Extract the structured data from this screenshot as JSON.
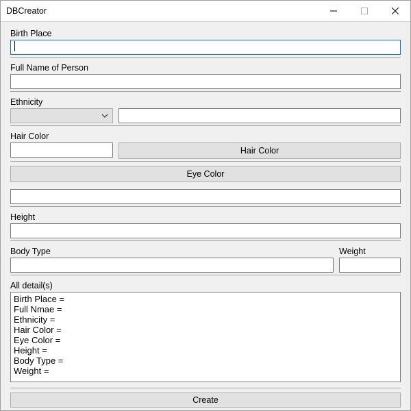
{
  "window": {
    "title": "DBCreator"
  },
  "labels": {
    "birth_place": "Birth Place",
    "full_name": "Full Name of Person",
    "ethnicity": "Ethnicity",
    "hair_color": "Hair Color",
    "height": "Height",
    "body_type": "Body Type",
    "weight": "Weight",
    "all_details": "All detail(s)"
  },
  "buttons": {
    "hair_color": "Hair Color",
    "eye_color": "Eye Color",
    "create": "Create"
  },
  "inputs": {
    "birth_place": "",
    "full_name": "",
    "ethnicity_selected": "",
    "ethnicity_text": "",
    "hair_color": "",
    "eye_color_result": "",
    "height": "",
    "body_type": "",
    "weight": ""
  },
  "details_text": "Birth Place = \nFull Nmae = \nEthnicity = \nHair Color = \nEye Color = \nHeight = \nBody Type = \nWeight = "
}
